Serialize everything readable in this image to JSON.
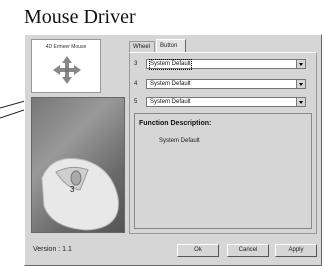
{
  "page_title": "Mouse Driver",
  "brand": {
    "label": "4D Ermeer Mouse",
    "logo": "four-arrows-icon"
  },
  "tabs": [
    {
      "label": "Wheel"
    },
    {
      "label": "Button"
    }
  ],
  "rows": [
    {
      "number": "3",
      "value": "System Default"
    },
    {
      "number": "4",
      "value": "System Default"
    },
    {
      "number": "5",
      "value": "System Default"
    }
  ],
  "description": {
    "title": "Function Description:",
    "value": "System Default"
  },
  "version": "Version : 1.1",
  "buttons": {
    "ok": "Ok",
    "cancel": "Cancel",
    "apply": "Apply"
  },
  "photo": {
    "button_label": "3"
  }
}
